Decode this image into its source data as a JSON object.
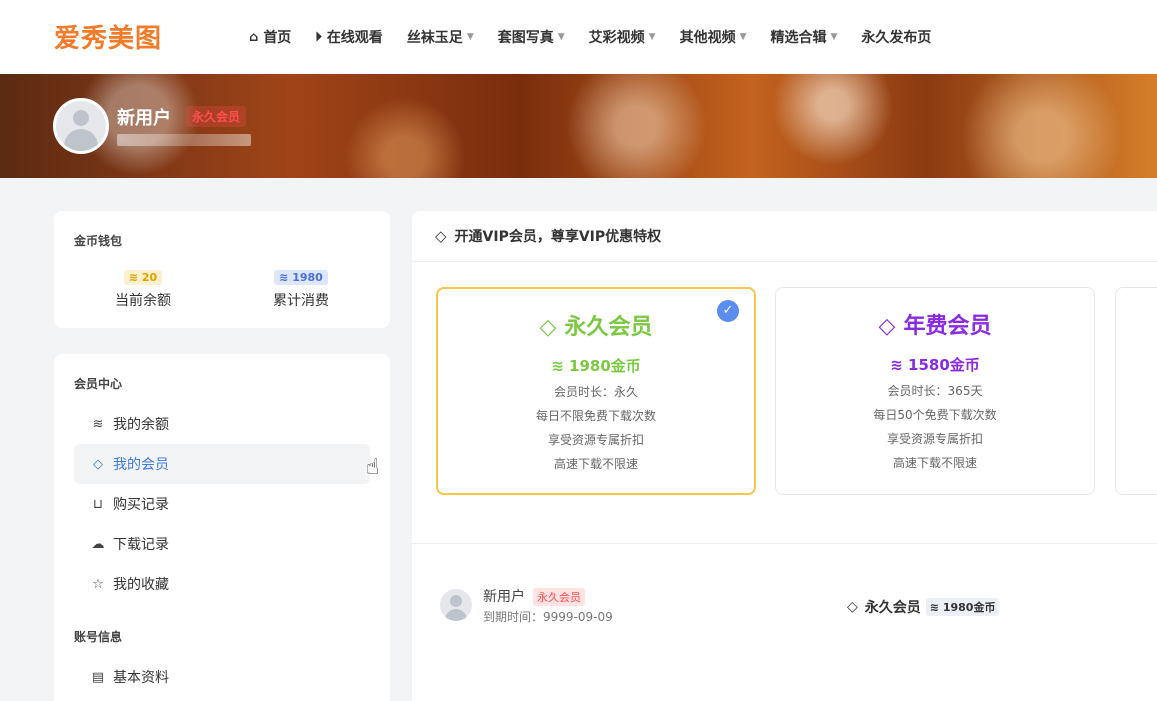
{
  "brand": {
    "logo_text": "爱秀美图"
  },
  "nav": [
    {
      "label": "首页",
      "icon": "home-icon",
      "dropdown": false
    },
    {
      "label": "在线观看",
      "icon": "play-circle-icon",
      "dropdown": false
    },
    {
      "label": "丝袜玉足",
      "dropdown": true
    },
    {
      "label": "套图写真",
      "dropdown": true
    },
    {
      "label": "艾彩视频",
      "dropdown": true
    },
    {
      "label": "其他视频",
      "dropdown": true
    },
    {
      "label": "精选合辑",
      "dropdown": true
    },
    {
      "label": "永久发布页",
      "dropdown": false
    }
  ],
  "banner": {
    "username": "新用户",
    "badge": "永久会员"
  },
  "wallet": {
    "title": "金币钱包",
    "balance_value": "20",
    "balance_label": "当前余额",
    "spent_value": "1980",
    "spent_label": "累计消费"
  },
  "member_center": {
    "title": "会员中心",
    "items": [
      {
        "label": "我的余额",
        "icon": "coins-icon"
      },
      {
        "label": "我的会员",
        "icon": "diamond-icon"
      },
      {
        "label": "购买记录",
        "icon": "basket-icon"
      },
      {
        "label": "下载记录",
        "icon": "cloud-download-icon"
      },
      {
        "label": "我的收藏",
        "icon": "star-icon"
      }
    ],
    "active_index": 1
  },
  "account_info": {
    "title": "账号信息",
    "items": [
      {
        "label": "基本资料",
        "icon": "id-card-icon"
      }
    ]
  },
  "main": {
    "heading": "开通VIP会员，尊享VIP优惠特权",
    "plans": [
      {
        "name": "永久会员",
        "price": "1980金币",
        "color": "#7ac943",
        "selected": true,
        "features": [
          "会员时长：永久",
          "每日不限免费下载次数",
          "享受资源专属折扣",
          "高速下载不限速"
        ]
      },
      {
        "name": "年费会员",
        "price": "1580金币",
        "color": "#8a2be2",
        "selected": false,
        "features": [
          "会员时长：365天",
          "每日50个免费下载次数",
          "享受资源专属折扣",
          "高速下载不限速"
        ]
      }
    ],
    "summary": {
      "username": "新用户",
      "badge": "永久会员",
      "expiry": "到期时间：9999-09-09",
      "plan_name": "永久会员",
      "plan_price": "1980金币"
    }
  },
  "colors": {
    "accent": "#3d7be0",
    "logo": "#f07b28",
    "selected_border": "#f5c64a",
    "badge_red": "#ff4d4f"
  }
}
